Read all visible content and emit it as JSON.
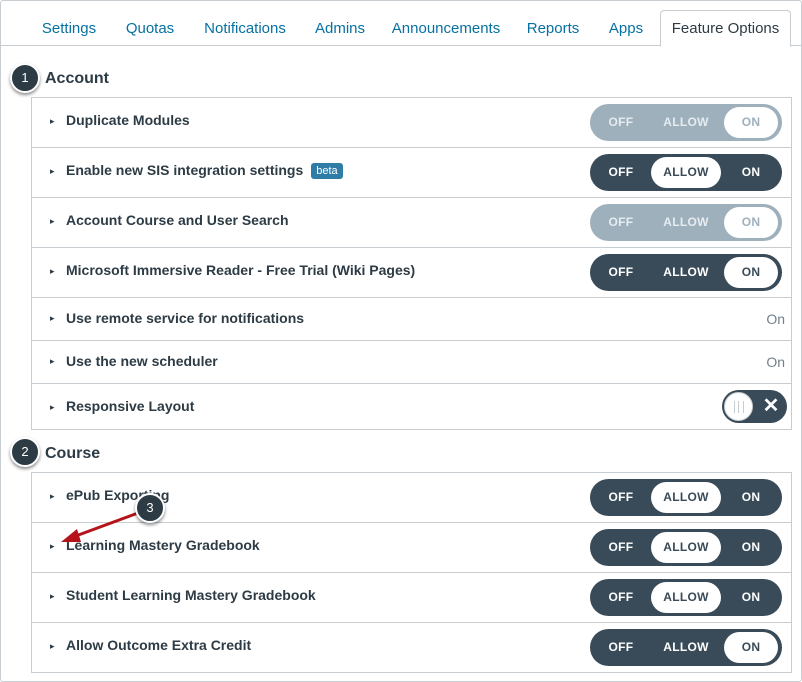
{
  "tabs": [
    {
      "label": "Settings"
    },
    {
      "label": "Quotas"
    },
    {
      "label": "Notifications"
    },
    {
      "label": "Admins"
    },
    {
      "label": "Announcements"
    },
    {
      "label": "Reports"
    },
    {
      "label": "Apps"
    },
    {
      "label": "Feature Options",
      "active": true
    }
  ],
  "toggle_labels": {
    "off": "OFF",
    "allow": "ALLOW",
    "on": "ON"
  },
  "account": {
    "title": "Account",
    "marker": "1",
    "features": [
      {
        "label": "Duplicate Modules",
        "state": "ON",
        "locked": true
      },
      {
        "label": "Enable new SIS integration settings",
        "badge": "beta",
        "state": "ALLOW"
      },
      {
        "label": "Account Course and User Search",
        "state": "ON",
        "locked": true
      },
      {
        "label": "Microsoft Immersive Reader - Free Trial (Wiki Pages)",
        "state": "ON"
      },
      {
        "label": "Use remote service for notifications",
        "status": "On"
      },
      {
        "label": "Use the new scheduler",
        "status": "On"
      },
      {
        "label": "Responsive Layout",
        "switch": "off",
        "switch_icon": "x-icon"
      }
    ]
  },
  "course": {
    "title": "Course",
    "marker": "2",
    "features": [
      {
        "label": "ePub Exporting",
        "state": "ALLOW"
      },
      {
        "label": "Learning Mastery Gradebook",
        "state": "ALLOW"
      },
      {
        "label": "Student Learning Mastery Gradebook",
        "state": "ALLOW"
      },
      {
        "label": "Allow Outcome Extra Credit",
        "state": "ON"
      }
    ]
  },
  "callout": {
    "marker": "3",
    "color": "#b4131a"
  },
  "colors": {
    "link": "#0770a3",
    "toggle_dark": "#394b58",
    "toggle_disabled": "#9fb0bd",
    "badge_beta": "#2f7ca6",
    "text": "#2d3b45"
  },
  "row_arrow_glyph": "▸"
}
